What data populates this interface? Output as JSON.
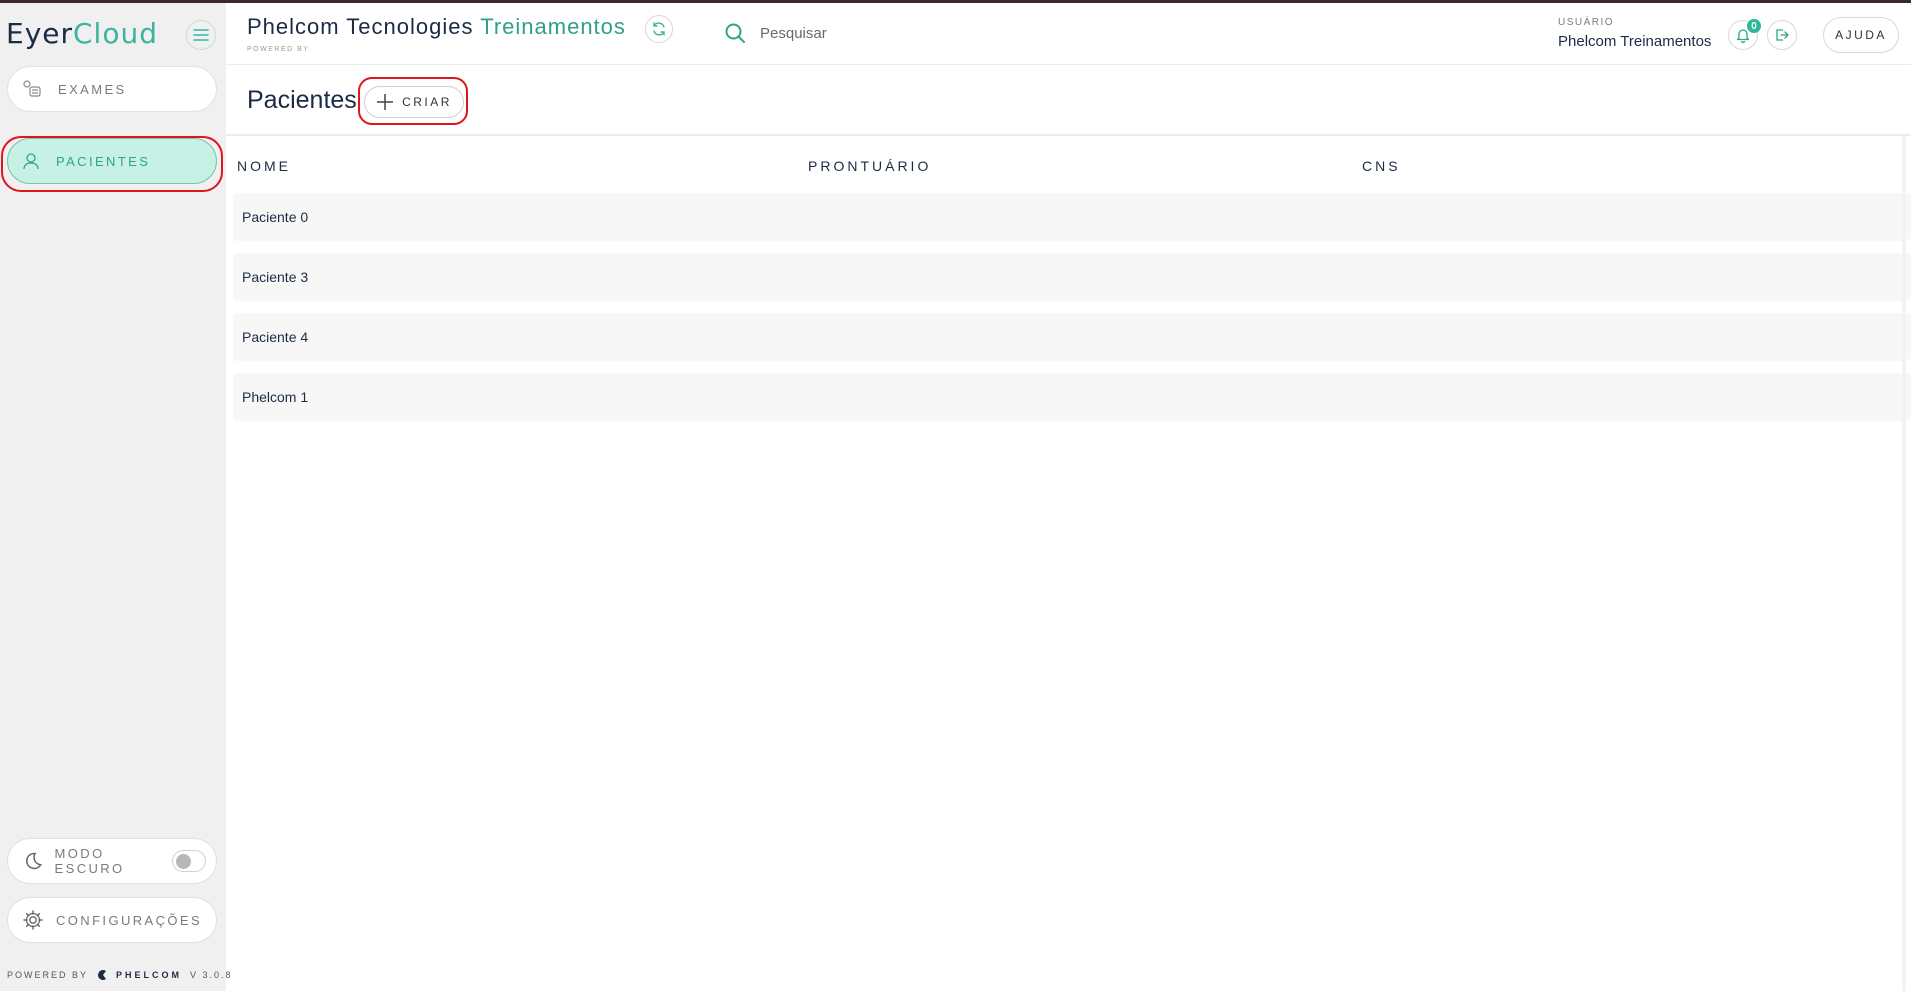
{
  "app": {
    "logo_part1": "Eyer",
    "logo_part2": "Cloud"
  },
  "sidebar": {
    "items": [
      {
        "label": "EXAMES",
        "icon": "exams-icon"
      },
      {
        "label": "PACIENTES",
        "icon": "user-icon",
        "active": true
      }
    ],
    "dark_mode_label": "MODO ESCURO",
    "dark_mode_on": false,
    "settings_label": "CONFIGURAÇÕES",
    "powered_by": "POWERED BY",
    "brand": "PHELCOM",
    "version": "V 3.0.8"
  },
  "header": {
    "org_name_part1": "Phelcom Tecnologies",
    "org_name_part2": "Treinamentos",
    "org_sub": "POWERED BY",
    "search_placeholder": "Pesquisar",
    "user_caption": "USUÁRIO",
    "user_name": "Phelcom Treinamentos",
    "notifications_count": "0",
    "help_label": "AJUDA"
  },
  "page": {
    "title": "Pacientes",
    "create_label": "CRIAR"
  },
  "table": {
    "columns": [
      "NOME",
      "PRONTUÁRIO",
      "CNS"
    ],
    "rows": [
      {
        "nome": "Paciente 0",
        "prontuario": "",
        "cns": ""
      },
      {
        "nome": "Paciente 3",
        "prontuario": "",
        "cns": ""
      },
      {
        "nome": "Paciente 4",
        "prontuario": "",
        "cns": ""
      },
      {
        "nome": "Phelcom 1",
        "prontuario": "",
        "cns": ""
      }
    ]
  },
  "colors": {
    "accent": "#3cb5a0",
    "active_bg": "#c8f1e5",
    "navy": "#1c2b45",
    "annotation": "#e0141c"
  }
}
